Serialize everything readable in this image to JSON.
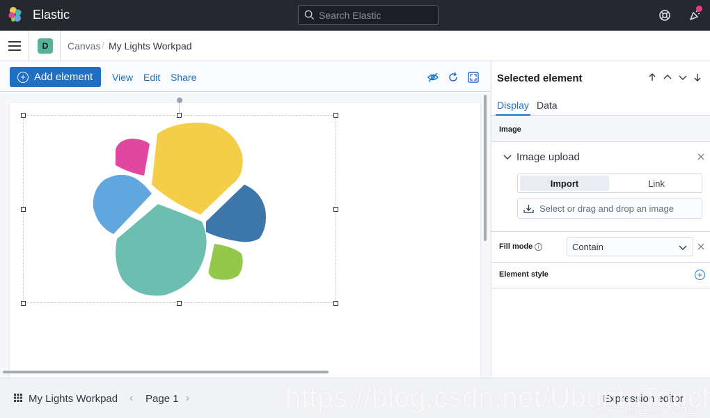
{
  "header": {
    "brand": "Elastic",
    "search_placeholder": "Search Elastic"
  },
  "breadcrumb": {
    "space_initial": "D",
    "items": [
      "Canvas",
      "My Lights Workpad"
    ]
  },
  "toolbar": {
    "add_element": "Add element",
    "view": "View",
    "edit": "Edit",
    "share": "Share"
  },
  "panel": {
    "title": "Selected element",
    "tabs": [
      "Display",
      "Data"
    ],
    "image_section": "Image",
    "image_upload": "Image upload",
    "import": "Import",
    "link": "Link",
    "dropzone": "Select or drag and drop an image",
    "fill_mode_label": "Fill mode",
    "fill_mode_value": "Contain",
    "element_style": "Element style"
  },
  "footer": {
    "workpad": "My Lights Workpad",
    "page": "Page 1",
    "expression_editor": "Expression editor"
  },
  "watermark": {
    "url": "https://blog.csdn.net/UbuntuTouch",
    "community": "@稀土掘金技术社区"
  },
  "colors": {
    "accent": "#1f6fc5",
    "header_bg": "#25282f",
    "pink": "#e0479e",
    "yellow": "#f4ce49",
    "light_blue": "#61a7de",
    "teal": "#6cbfb0",
    "dark_blue": "#3d76a8",
    "green": "#93c84a"
  }
}
